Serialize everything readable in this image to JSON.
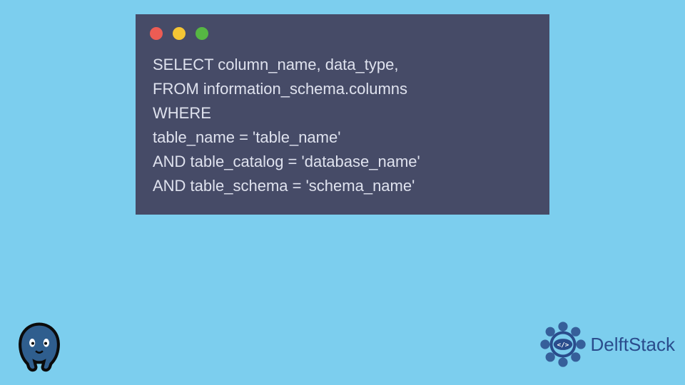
{
  "window": {
    "dot_colors": {
      "red": "#ec5c54",
      "yellow": "#f4c534",
      "green": "#56b743"
    }
  },
  "code": {
    "line1": "SELECT column_name, data_type,",
    "line2": "FROM information_schema.columns",
    "line3": "WHERE",
    "line4": "table_name = 'table_name'",
    "line5": "AND table_catalog = 'database_name'",
    "line6": "AND table_schema = 'schema_name'"
  },
  "brand": {
    "name": "DelftStack"
  },
  "icons": {
    "postgres": "postgresql-elephant",
    "delftstack": "delftstack-gear-code"
  }
}
